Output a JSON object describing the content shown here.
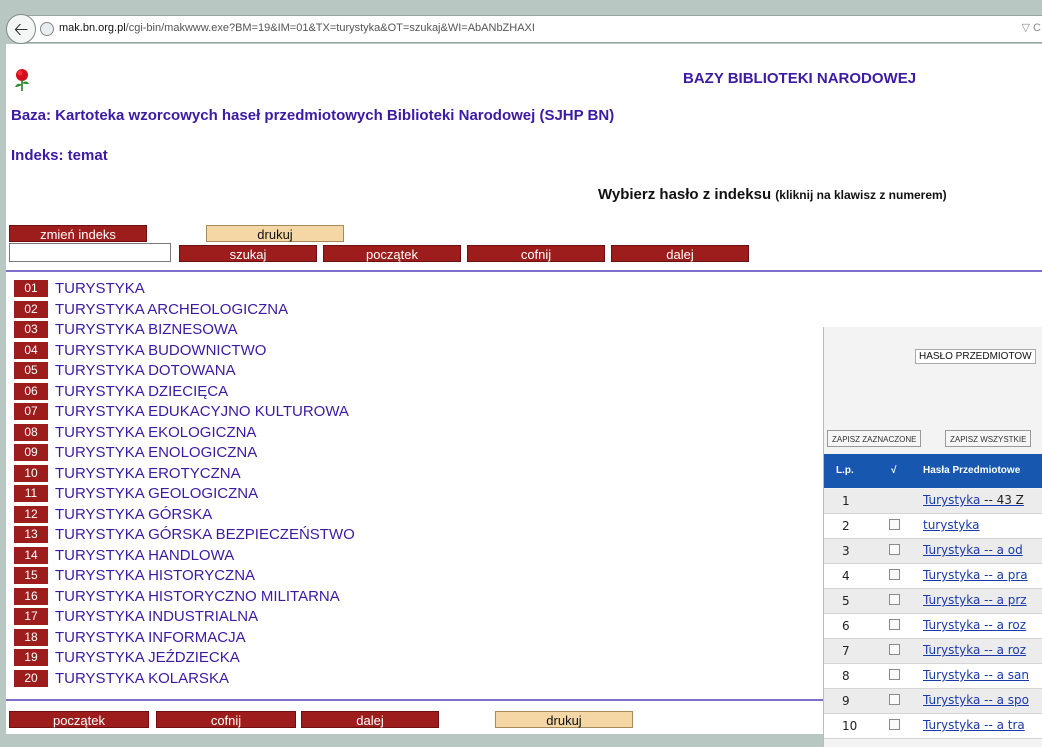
{
  "browser": {
    "url_host": "mak.bn.org.pl",
    "url_path": "/cgi-bin/makwww.exe?BM=19&IM=01&TX=turystyka&OT=szukaj&WI=AbANbZHAXI",
    "url_right": "▽ C"
  },
  "header": {
    "title": "BAZY BIBLIOTEKI NARODOWEJ",
    "baza": "Baza: Kartoteka wzorcowych haseł przedmiotowych Biblioteki Narodowej (SJHP BN)",
    "indeks": "Indeks: temat",
    "instruction": "Wybierz hasło z indeksu",
    "instruction_small": "(kliknij na klawisz z numerem)"
  },
  "controls": {
    "change_index": "zmień indeks",
    "print": "drukuj",
    "search": "szukaj",
    "start": "początek",
    "back": "cofnij",
    "next": "dalej",
    "search_value": ""
  },
  "entries": [
    {
      "num": "01",
      "term": "TURYSTYKA"
    },
    {
      "num": "02",
      "term": "TURYSTYKA ARCHEOLOGICZNA"
    },
    {
      "num": "03",
      "term": "TURYSTYKA BIZNESOWA"
    },
    {
      "num": "04",
      "term": "TURYSTYKA BUDOWNICTWO"
    },
    {
      "num": "05",
      "term": "TURYSTYKA DOTOWANA"
    },
    {
      "num": "06",
      "term": "TURYSTYKA DZIECIĘCA"
    },
    {
      "num": "07",
      "term": "TURYSTYKA EDUKACYJNO KULTUROWA"
    },
    {
      "num": "08",
      "term": "TURYSTYKA EKOLOGICZNA"
    },
    {
      "num": "09",
      "term": "TURYSTYKA ENOLOGICZNA"
    },
    {
      "num": "10",
      "term": "TURYSTYKA EROTYCZNA"
    },
    {
      "num": "11",
      "term": "TURYSTYKA GEOLOGICZNA"
    },
    {
      "num": "12",
      "term": "TURYSTYKA GÓRSKA"
    },
    {
      "num": "13",
      "term": "TURYSTYKA GÓRSKA BEZPIECZEŃSTWO"
    },
    {
      "num": "14",
      "term": "TURYSTYKA HANDLOWA"
    },
    {
      "num": "15",
      "term": "TURYSTYKA HISTORYCZNA"
    },
    {
      "num": "16",
      "term": "TURYSTYKA HISTORYCZNO MILITARNA"
    },
    {
      "num": "17",
      "term": "TURYSTYKA INDUSTRIALNA"
    },
    {
      "num": "18",
      "term": "TURYSTYKA INFORMACJA"
    },
    {
      "num": "19",
      "term": "TURYSTYKA JEŹDZIECKA"
    },
    {
      "num": "20",
      "term": "TURYSTYKA KOLARSKA"
    }
  ],
  "popup": {
    "heading": "HASŁO PRZEDMIOTOW",
    "save_selected": "ZAPISZ ZAZNACZONE",
    "save_all": "ZAPISZ WSZYSTKIE",
    "col_lp": "L.p.",
    "col_check": "√",
    "col_hasla": "Hasła Przedmiotowe",
    "rows": [
      {
        "lp": "1",
        "link": "Turystyka",
        "rest": " -- 43 Z"
      },
      {
        "lp": "2",
        "link": "turystyka",
        "rest": ""
      },
      {
        "lp": "3",
        "link": "Turystyka -- a od",
        "rest": ""
      },
      {
        "lp": "4",
        "link": "Turystyka -- a pra",
        "rest": ""
      },
      {
        "lp": "5",
        "link": "Turystyka -- a prz",
        "rest": ""
      },
      {
        "lp": "6",
        "link": "Turystyka -- a roz",
        "rest": ""
      },
      {
        "lp": "7",
        "link": "Turystyka -- a roz",
        "rest": ""
      },
      {
        "lp": "8",
        "link": "Turystyka -- a san",
        "rest": ""
      },
      {
        "lp": "9",
        "link": "Turystyka -- a spo",
        "rest": ""
      },
      {
        "lp": "10",
        "link": "Turystyka -- a tra",
        "rest": ""
      }
    ]
  }
}
